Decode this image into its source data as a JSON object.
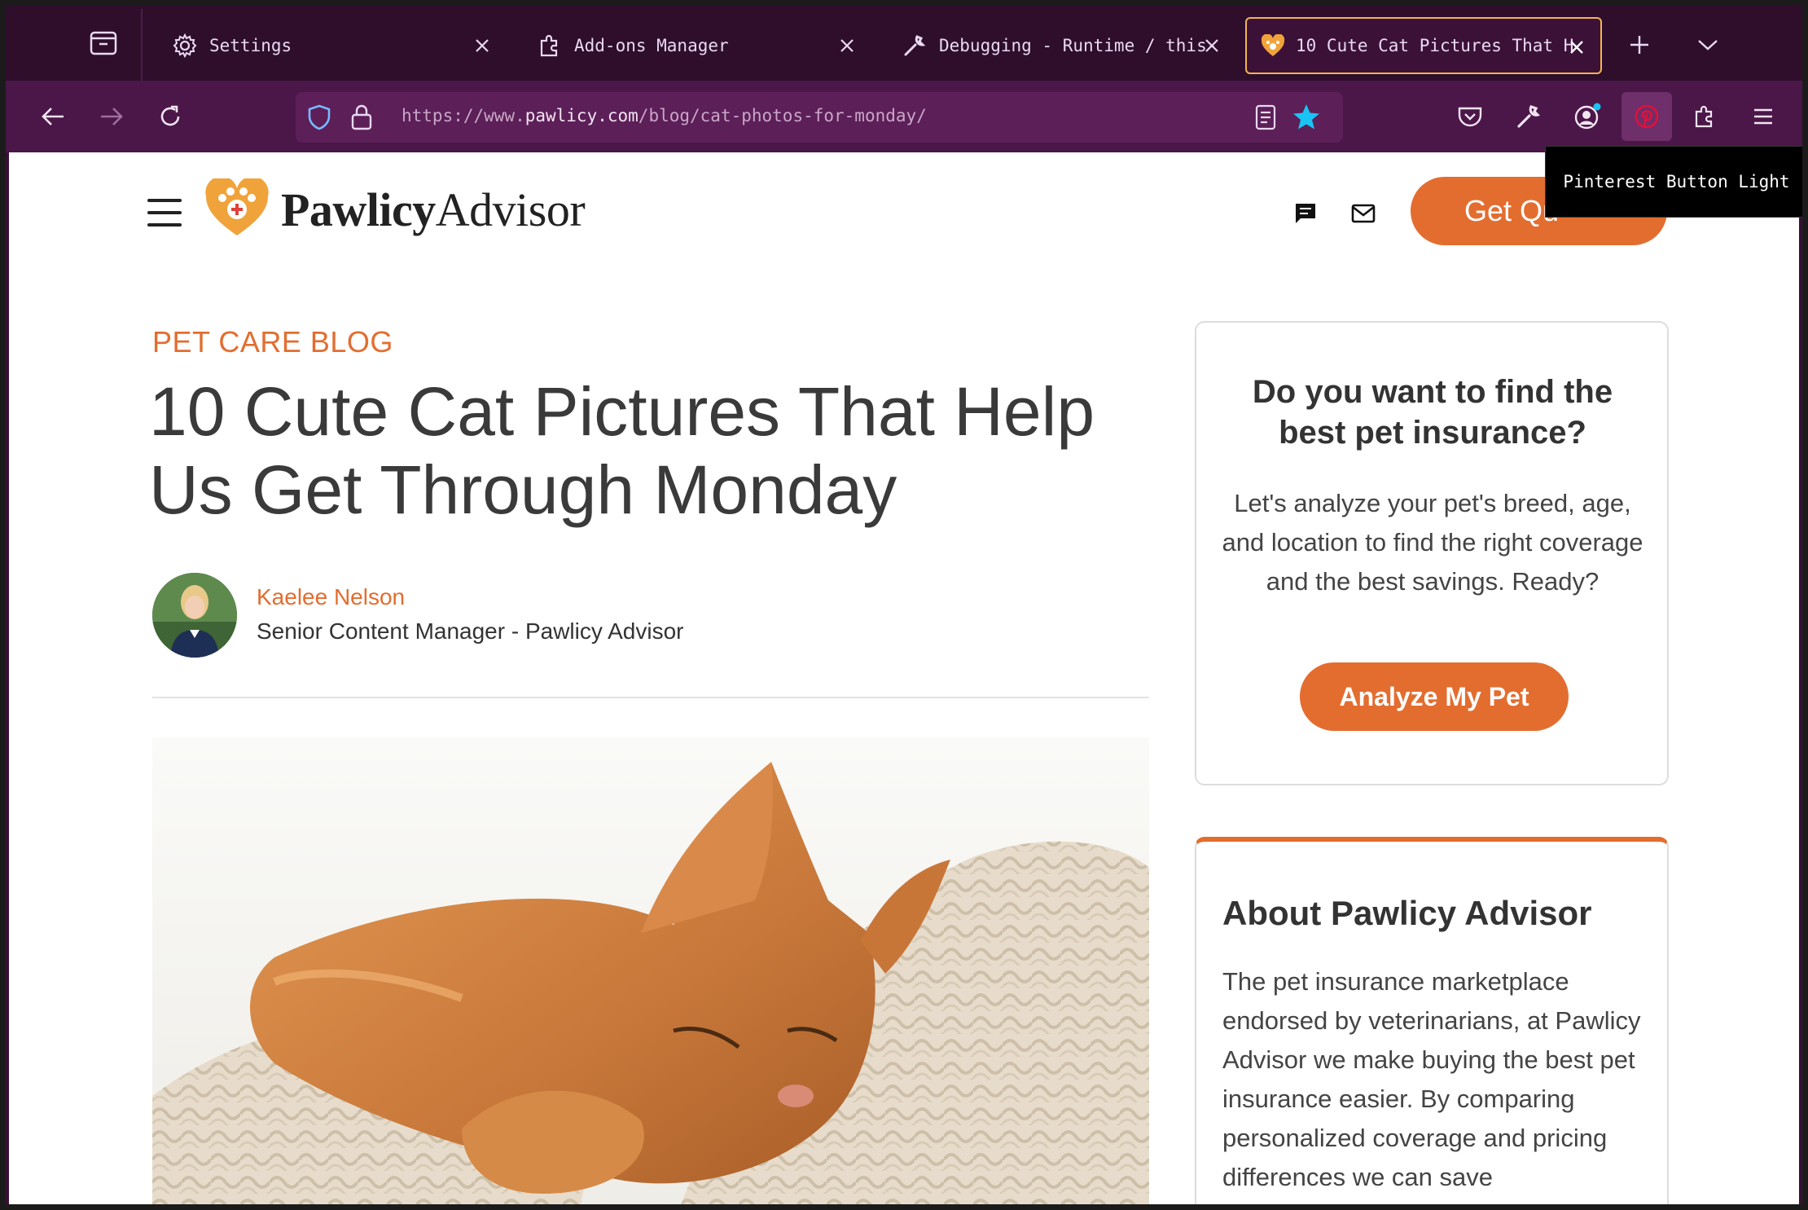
{
  "browser": {
    "tabs": [
      {
        "label": "Settings",
        "icon": "gear-icon"
      },
      {
        "label": "Add-ons Manager",
        "icon": "puzzle-icon"
      },
      {
        "label": "Debugging - Runtime / this-",
        "icon": "wrench-icon"
      },
      {
        "label": "10 Cute Cat Pictures That H",
        "icon": "pawlicy-favicon",
        "active": true
      }
    ],
    "url": {
      "scheme": "https://www.",
      "domain": "pawlicy.com",
      "path": "/blog/cat-photos-for-monday/"
    },
    "tooltip": "Pinterest Button Light",
    "colors": {
      "tab_strip": "#2f0e2c",
      "nav_bar": "#4a1748",
      "active_tab_border": "#f4b54c",
      "bookmark_star": "#19c4f4"
    }
  },
  "site": {
    "logo": {
      "bold": "Pawlicy",
      "regular": "Advisor"
    },
    "quote_button": "Get Qu",
    "accent": "#e36d2f"
  },
  "article": {
    "kicker": "PET CARE BLOG",
    "title": "10 Cute Cat Pictures That Help Us Get Through Monday",
    "author": {
      "name": "Kaelee Nelson",
      "role": "Senior Content Manager - Pawlicy Advisor"
    }
  },
  "sidebar": {
    "cta": {
      "heading": "Do you want to find the best pet insurance?",
      "body": "Let's analyze your pet's breed, age, and location to find the right coverage and the best savings. Ready?",
      "button": "Analyze My Pet"
    },
    "about": {
      "heading": "About Pawlicy Advisor",
      "body": "The pet insurance marketplace endorsed by veterinarians, at Pawlicy Advisor we make buying the best pet insurance easier. By comparing personalized coverage and pricing differences we can save"
    }
  }
}
